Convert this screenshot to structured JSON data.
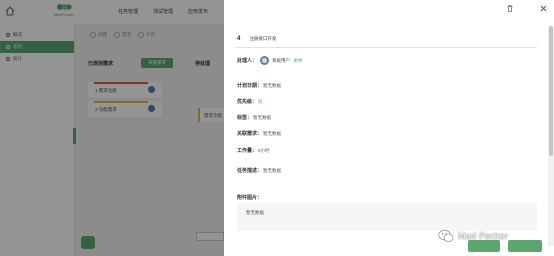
{
  "topbar": {
    "logo_text": "MadPecker",
    "nav": [
      "任务管理",
      "测试管理",
      "应用发布"
    ]
  },
  "sidebar": {
    "items": [
      {
        "label": "概况",
        "active": false
      },
      {
        "label": "迭代",
        "active": true
      },
      {
        "label": "统计",
        "active": false
      }
    ]
  },
  "board": {
    "stages": [
      "创建",
      "需求",
      "计划"
    ],
    "column_title": "已规划需求",
    "add_button": "关联需求",
    "second_column": "待处理",
    "cards": [
      {
        "title": "1 需求功能",
        "bar_color": "#e6584f"
      },
      {
        "title": "2 功能需求",
        "bar_color": "#e8b34b"
      }
    ],
    "side_card": "需求功能"
  },
  "drawer": {
    "task_id": "4",
    "task_title": "注册接口开发",
    "owner_label": "处理人：",
    "owner_name": "系统用户",
    "owner_action": "更换",
    "fields": [
      {
        "label": "计划日期：",
        "value": "暂无数据",
        "green": false
      },
      {
        "label": "优先级：",
        "value": "低",
        "green": true
      },
      {
        "label": "标签：",
        "value": "暂无数据",
        "green": false
      },
      {
        "label": "关联需求：",
        "value": "暂无数据",
        "green": false
      },
      {
        "label": "工作量：",
        "value": "0小时",
        "green": false
      },
      {
        "label": "任务描述：",
        "value": "暂无数据",
        "green": false
      }
    ],
    "attach_label": "附件图片：",
    "attach_value": "暂无数据"
  },
  "watermark": {
    "text": "Mad Pecker"
  },
  "colors": {
    "accent": "#5aa870",
    "overlay": "rgba(0,0,0,0.42)"
  }
}
